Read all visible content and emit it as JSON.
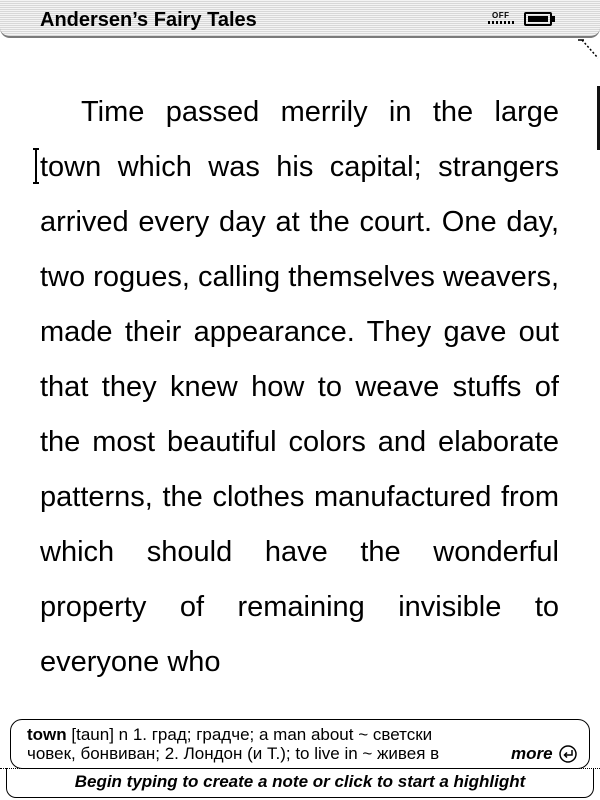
{
  "header": {
    "book_title": "Andersen’s Fairy Tales",
    "wireless_status": "OFF",
    "battery_level": 1.0,
    "wireless_icon": "wireless-off-icon",
    "battery_icon": "battery-icon"
  },
  "page": {
    "text": "Time passed merrily in the large town which was his capital; strangers arrived every day at the court. One day, two rogues, calling themselves weavers, made their appearance. They gave out that they knew how to weave stuffs of the most beautiful colors and elaborate patterns, the clothes manufactured from which should have the wonderful property of remaining invisible to everyone who"
  },
  "dictionary": {
    "word": "town",
    "line1_rest": " [taun] n 1. град; градче; a man about ~ светски",
    "line2": "човек, бонвиван; 2. Лондон (и Т.); to live in ~ живея в",
    "more_label": "more",
    "more_icon": "enter-icon"
  },
  "status": {
    "hint": "Begin typing to create a note or click to start a highlight"
  }
}
